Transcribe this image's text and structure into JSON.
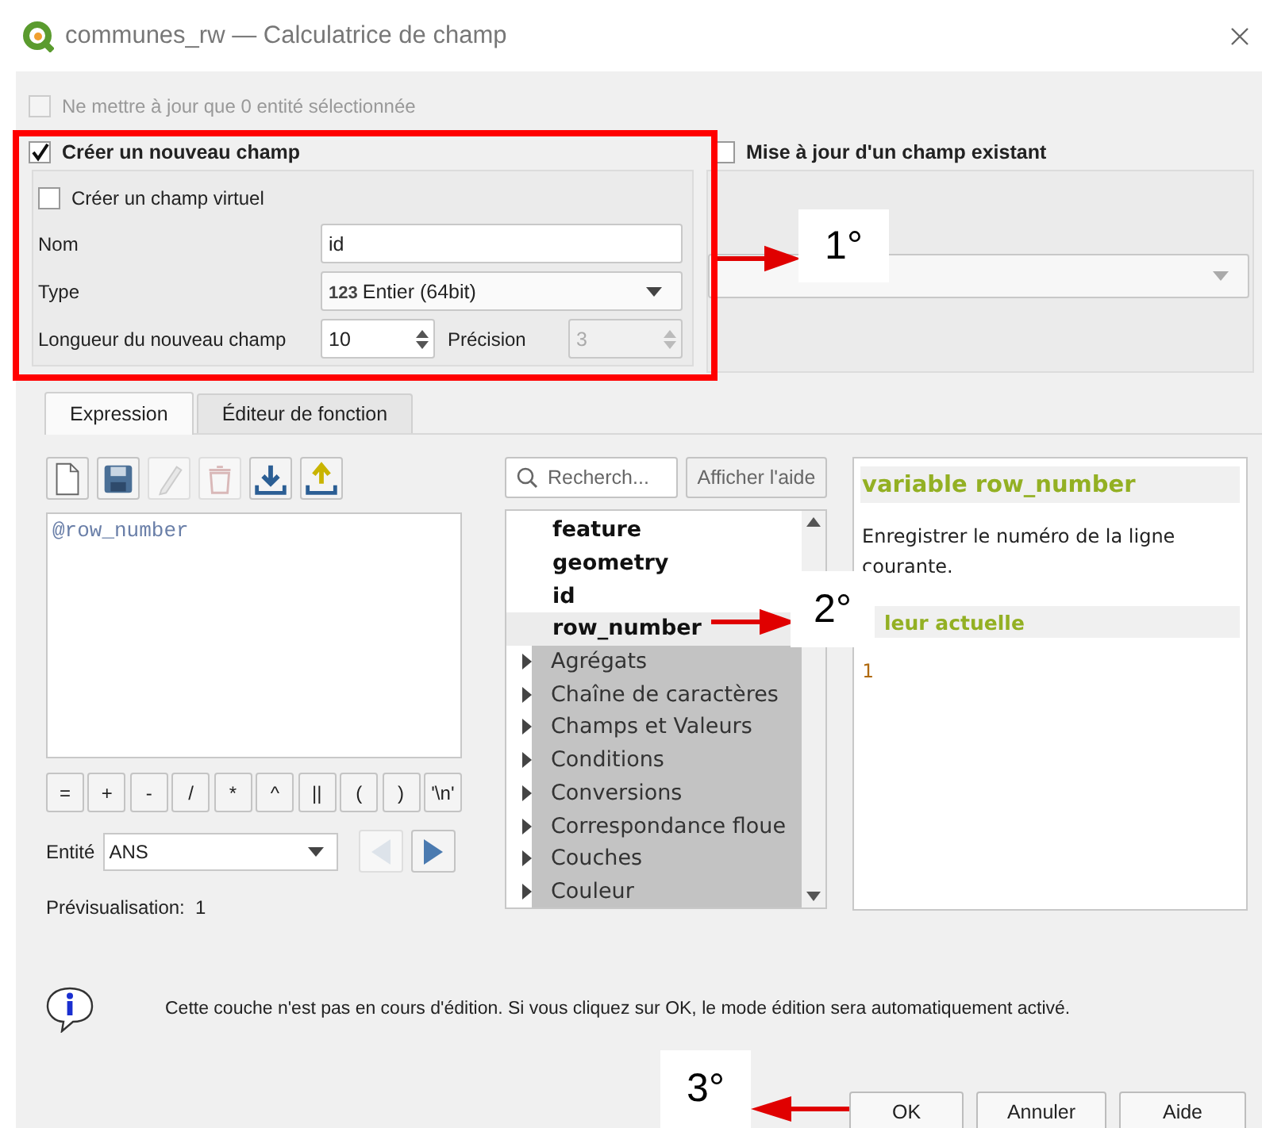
{
  "window": {
    "title": "communes_rw — Calculatrice de champ"
  },
  "only_selected": {
    "label": "Ne mettre à jour que 0 entité sélectionnée",
    "checked": false,
    "disabled": true
  },
  "new_field": {
    "label": "Créer un nouveau champ",
    "checked": true,
    "virtual": {
      "label": "Créer un champ virtuel",
      "checked": false
    },
    "name": {
      "label": "Nom",
      "value": "id"
    },
    "type": {
      "label": "Type",
      "type_icon": "123",
      "value": "Entier (64bit)"
    },
    "length": {
      "label": "Longueur du nouveau champ",
      "value": "10"
    },
    "precision": {
      "label": "Précision",
      "value": "3",
      "disabled": true
    }
  },
  "update_field": {
    "label": "Mise à jour d'un champ existant",
    "checked": false
  },
  "tabs": [
    {
      "label": "Expression",
      "selected": true
    },
    {
      "label": "Éditeur de fonction",
      "selected": false
    }
  ],
  "tools": [
    {
      "kind": "new",
      "disabled": false
    },
    {
      "kind": "save",
      "disabled": false
    },
    {
      "kind": "edit",
      "disabled": true
    },
    {
      "kind": "delete",
      "disabled": true
    },
    {
      "kind": "import",
      "disabled": false
    },
    {
      "kind": "export",
      "disabled": false
    }
  ],
  "expression": "@row_number",
  "operators": [
    "=",
    "+",
    "-",
    "/",
    "*",
    "^",
    "||",
    "(",
    ")",
    "'\\n'"
  ],
  "entity": {
    "label": "Entité",
    "value": "ANS",
    "prev_disabled": true,
    "next_disabled": false
  },
  "preview": {
    "label": "Prévisualisation:",
    "value": "1"
  },
  "search": {
    "placeholder": "Recherch..."
  },
  "help_button": "Afficher l'aide",
  "tree": [
    {
      "label": "feature",
      "kind": "variable",
      "selected": false
    },
    {
      "label": "geometry",
      "kind": "variable",
      "selected": false
    },
    {
      "label": "id",
      "kind": "variable",
      "selected": false
    },
    {
      "label": "row_number",
      "kind": "variable",
      "selected": true
    },
    {
      "label": "Agrégats",
      "kind": "group",
      "selected": false
    },
    {
      "label": "Chaîne de caractères",
      "kind": "group",
      "selected": false
    },
    {
      "label": "Champs et Valeurs",
      "kind": "group",
      "selected": false
    },
    {
      "label": "Conditions",
      "kind": "group",
      "selected": false
    },
    {
      "label": "Conversions",
      "kind": "group",
      "selected": false
    },
    {
      "label": "Correspondance floue",
      "kind": "group",
      "selected": false
    },
    {
      "label": "Couches",
      "kind": "group",
      "selected": false
    },
    {
      "label": "Couleur",
      "kind": "group",
      "selected": false
    }
  ],
  "help": {
    "title": "variable row_number",
    "description": "Enregistrer le numéro de la ligne courante.",
    "section": "leur actuelle",
    "value": "1"
  },
  "info": "Cette couche n'est pas en cours d'édition. Si vous cliquez sur OK, le mode édition sera automatiquement activé.",
  "buttons": [
    "OK",
    "Annuler",
    "Aide"
  ],
  "annotations": [
    {
      "label": "1°"
    },
    {
      "label": "2°"
    },
    {
      "label": "3°"
    }
  ]
}
